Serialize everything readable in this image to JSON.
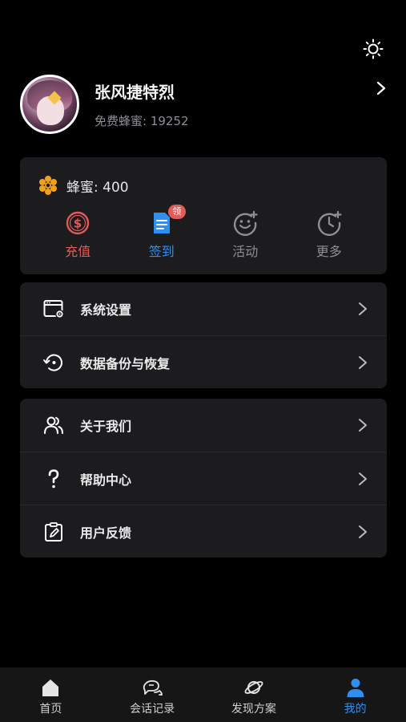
{
  "header": {
    "theme_icon": "sun-icon"
  },
  "profile": {
    "username": "张风捷特烈",
    "free_honey": "免费蜂蜜: 19252",
    "chevron_icon": "chevron-right-icon"
  },
  "wallet": {
    "honey_label": "蜂蜜: 400",
    "actions": [
      {
        "label": "充值",
        "icon": "dollar-circle-icon",
        "color": "#e25b5b"
      },
      {
        "label": "签到",
        "icon": "document-icon",
        "color": "#2f8ff0",
        "badge": "领"
      },
      {
        "label": "活动",
        "icon": "smiley-plus-icon",
        "color": "#8e8e93"
      },
      {
        "label": "更多",
        "icon": "clock-plus-icon",
        "color": "#8e8e93"
      }
    ]
  },
  "menu1": [
    {
      "label": "系统设置",
      "icon": "settings-window-icon"
    },
    {
      "label": "数据备份与恢复",
      "icon": "restore-icon"
    }
  ],
  "menu2": [
    {
      "label": "关于我们",
      "icon": "users-icon"
    },
    {
      "label": "帮助中心",
      "icon": "question-icon"
    },
    {
      "label": "用户反馈",
      "icon": "feedback-clipboard-icon"
    }
  ],
  "tabbar": [
    {
      "label": "首页",
      "icon": "home-icon"
    },
    {
      "label": "会话记录",
      "icon": "chat-bubbles-icon"
    },
    {
      "label": "发现方案",
      "icon": "planet-icon"
    },
    {
      "label": "我的",
      "icon": "user-icon",
      "active": true
    }
  ],
  "colors": {
    "accent": "#2f8ff0",
    "danger": "#e25b5b",
    "card": "#1c1c1e",
    "honey": "#f0a020"
  }
}
